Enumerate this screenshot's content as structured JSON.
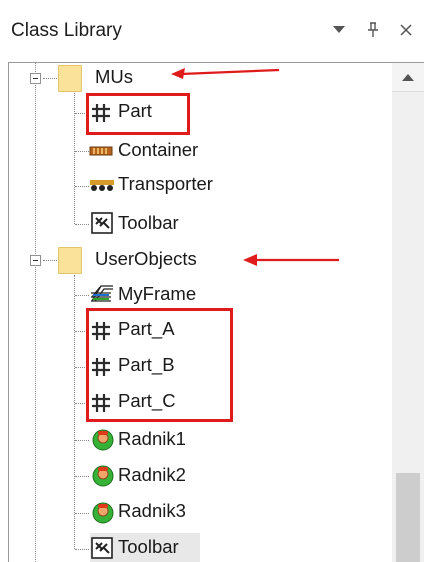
{
  "panel": {
    "title": "Class Library",
    "icons": [
      "dropdown-arrow-icon",
      "pin-icon",
      "close-icon"
    ]
  },
  "tree": {
    "items": [
      {
        "label": "MUs",
        "icon": "folder-icon",
        "expanded": true
      },
      {
        "label": "Part",
        "icon": "grid-icon"
      },
      {
        "label": "Container",
        "icon": "container-icon"
      },
      {
        "label": "Transporter",
        "icon": "transporter-icon"
      },
      {
        "label": "Toolbar",
        "icon": "toolbar-icon"
      },
      {
        "label": "UserObjects",
        "icon": "folder-icon",
        "expanded": true
      },
      {
        "label": "MyFrame",
        "icon": "frame-icon"
      },
      {
        "label": "Part_A",
        "icon": "grid-icon"
      },
      {
        "label": "Part_B",
        "icon": "grid-icon"
      },
      {
        "label": "Part_C",
        "icon": "grid-icon"
      },
      {
        "label": "Radnik1",
        "icon": "worker-icon"
      },
      {
        "label": "Radnik2",
        "icon": "worker-icon"
      },
      {
        "label": "Radnik3",
        "icon": "worker-icon"
      },
      {
        "label": "Toolbar",
        "icon": "toolbar-icon",
        "selected": true
      }
    ]
  },
  "annotations": {
    "highlight_color": "#e01b1b",
    "arrows": [
      "MUs",
      "UserObjects"
    ]
  }
}
